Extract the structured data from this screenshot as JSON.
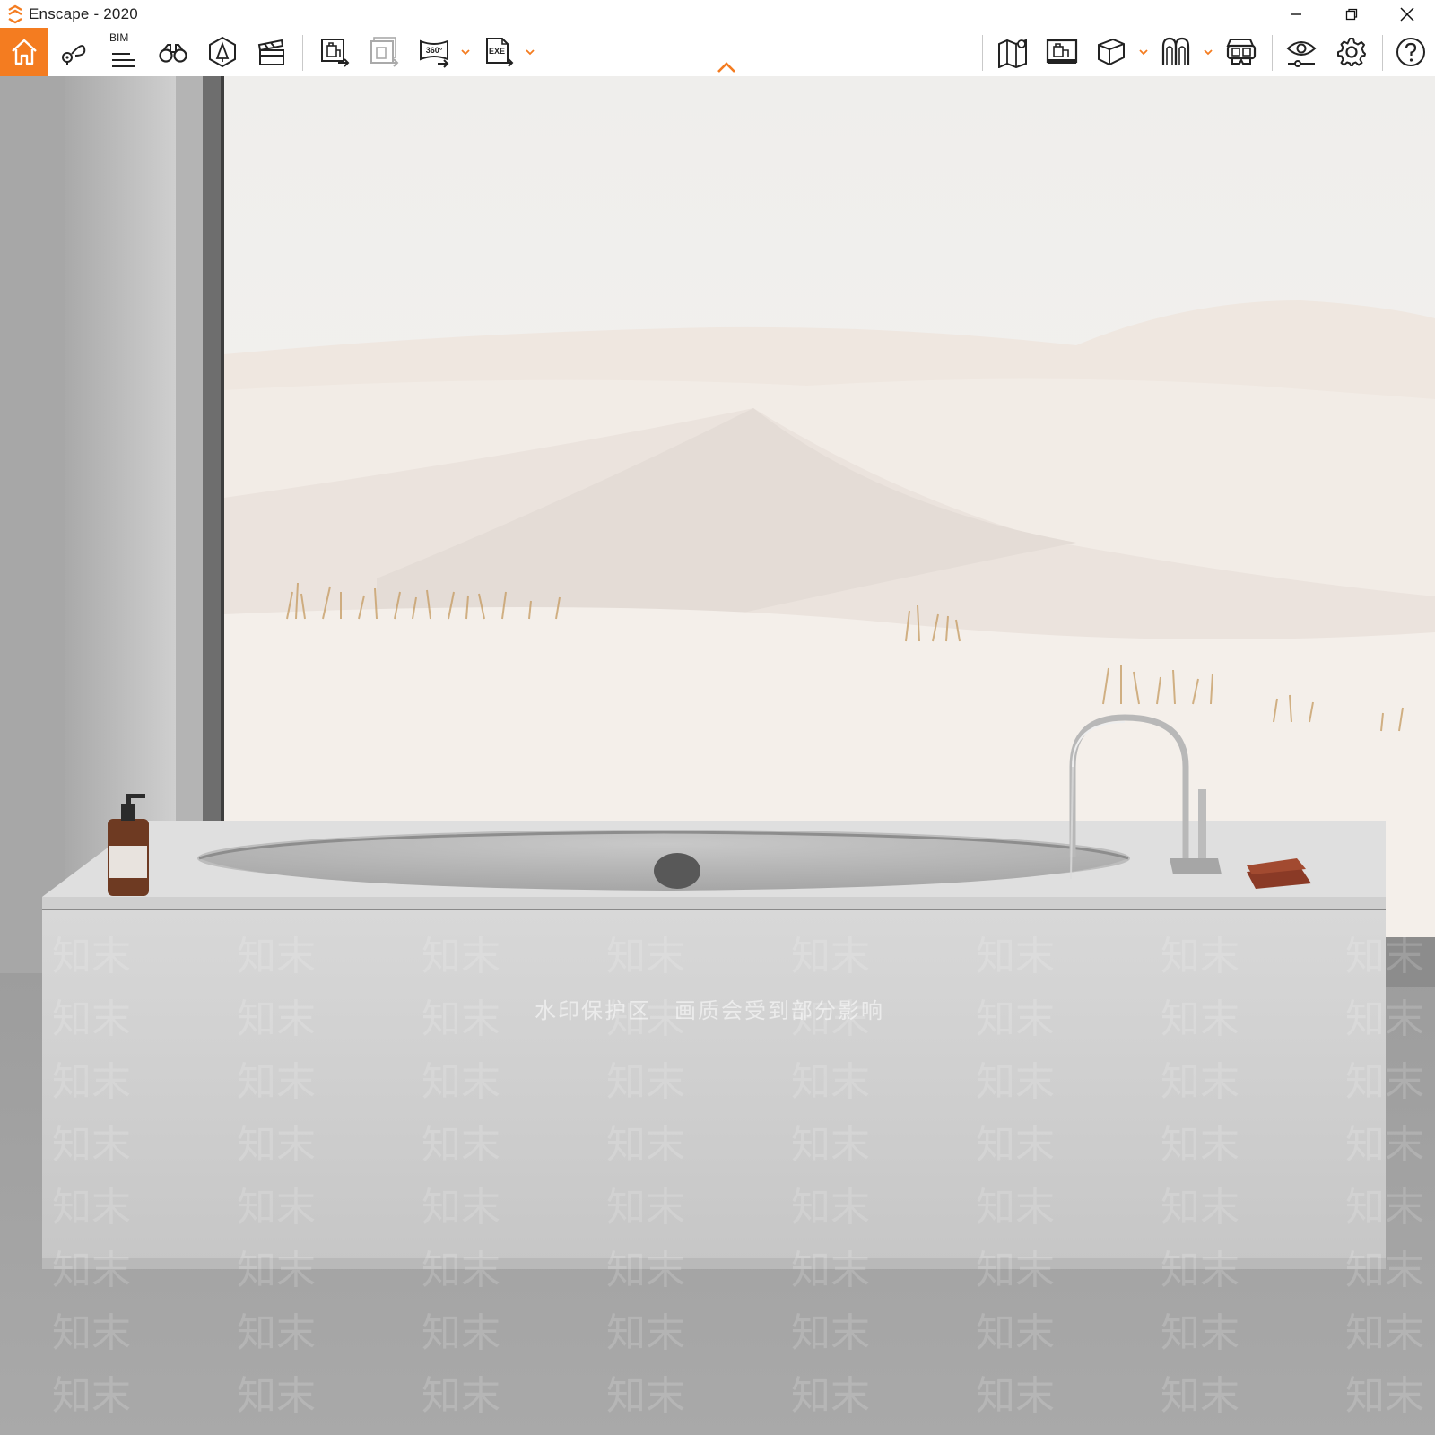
{
  "window": {
    "title": "Enscape - 2020"
  },
  "toolbar": {
    "bim_label": "BIM",
    "buttons": [
      {
        "id": "home",
        "icon": "home-icon"
      },
      {
        "id": "views",
        "icon": "view-pin-icon"
      },
      {
        "id": "bim",
        "icon": "bim-icon"
      },
      {
        "id": "explore",
        "icon": "binoculars-icon"
      },
      {
        "id": "assets",
        "icon": "asset-library-icon"
      },
      {
        "id": "video",
        "icon": "clapperboard-icon"
      },
      {
        "id": "render",
        "icon": "render-export-icon"
      },
      {
        "id": "batch",
        "icon": "batch-render-icon"
      },
      {
        "id": "panorama",
        "icon": "panorama-360-icon"
      },
      {
        "id": "exe",
        "icon": "exe-export-icon"
      },
      {
        "id": "map",
        "icon": "map-icon"
      },
      {
        "id": "screens",
        "icon": "screens-icon"
      },
      {
        "id": "cube",
        "icon": "cube-icon"
      },
      {
        "id": "atmosphere",
        "icon": "atmosphere-icon"
      },
      {
        "id": "vr",
        "icon": "vr-headset-icon"
      },
      {
        "id": "visual",
        "icon": "eye-settings-icon"
      },
      {
        "id": "settings",
        "icon": "gear-icon"
      },
      {
        "id": "help",
        "icon": "help-icon"
      }
    ],
    "badges": {
      "panorama": "360°",
      "exe": "EXE"
    }
  },
  "scene": {
    "watermark": "水印保护区　画质会受到部分影响",
    "watermark_tile": "知末",
    "colors": {
      "accent": "#f47c20",
      "sky": "#f1f0ee",
      "sand": "#f3ece6",
      "tub": "#d9d9d9",
      "floor": "#9f9f9f"
    }
  }
}
